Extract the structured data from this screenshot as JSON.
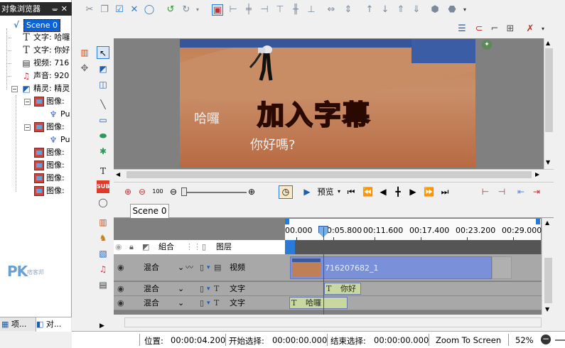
{
  "panel": {
    "title": "对象浏览器",
    "tree": [
      {
        "label": "Scene 0",
        "icon": "scene-icon",
        "indent": 0
      },
      {
        "label": "文字: 哈囉",
        "icon": "text-icon",
        "indent": 1
      },
      {
        "label": "文字: 你好",
        "icon": "text-icon",
        "indent": 1
      },
      {
        "label": "视频: 716",
        "icon": "video-icon",
        "indent": 1
      },
      {
        "label": "声音: 920",
        "icon": "music-icon",
        "indent": 1
      },
      {
        "label": "精灵: 精灵",
        "icon": "sprite-icon",
        "indent": 1
      },
      {
        "label": "图像:",
        "icon": "image-icon",
        "indent": 2
      },
      {
        "label": "Pu",
        "icon": "pin-icon",
        "indent": 3
      },
      {
        "label": "图像:",
        "icon": "image-icon",
        "indent": 2
      },
      {
        "label": "Pu",
        "icon": "pin-icon",
        "indent": 3
      },
      {
        "label": "图像:",
        "icon": "image-icon",
        "indent": 2
      },
      {
        "label": "图像:",
        "icon": "image-icon",
        "indent": 2
      },
      {
        "label": "图像:",
        "icon": "image-icon",
        "indent": 2
      },
      {
        "label": "图像:",
        "icon": "image-icon",
        "indent": 2
      }
    ],
    "logo": "PK",
    "logo_sub": "痞客邦",
    "tabs": [
      "项...",
      "对..."
    ]
  },
  "canvas": {
    "main_title": "加入字幕",
    "subtitle_a": "哈囉",
    "subtitle_b": "你好嗎?"
  },
  "timeline_toolbar": {
    "preview_label": "预览"
  },
  "timeline": {
    "tab": "Scene 0",
    "ruler_ticks": [
      "00.000",
      "00:05.800",
      "00:11.600",
      "00:17.400",
      "00:23.200",
      "00:29.000"
    ],
    "header": {
      "blend": "組合",
      "layer": "图层"
    },
    "tracks": [
      {
        "blend": "混合",
        "type": "视频",
        "clip": "716207682_1"
      },
      {
        "blend": "混合",
        "type": "文字",
        "clip": "你好"
      },
      {
        "blend": "混合",
        "type": "文字",
        "clip": "哈囉"
      }
    ]
  },
  "status": {
    "position_label": "位置:",
    "position_value": "00:00:04.200",
    "sel_start_label": "开始选择:",
    "sel_start_value": "00:00:00.000",
    "sel_end_label": "结束选择:",
    "sel_end_value": "00:00:00.000",
    "zoom_label": "Zoom To Screen",
    "zoom_value": "52%"
  },
  "colors": {
    "accent": "#0a64d8",
    "title_text": "#ff4a10",
    "clip_video": "#7a90d8",
    "clip_text": "#c8d8a0",
    "playhead": "#d02020"
  }
}
